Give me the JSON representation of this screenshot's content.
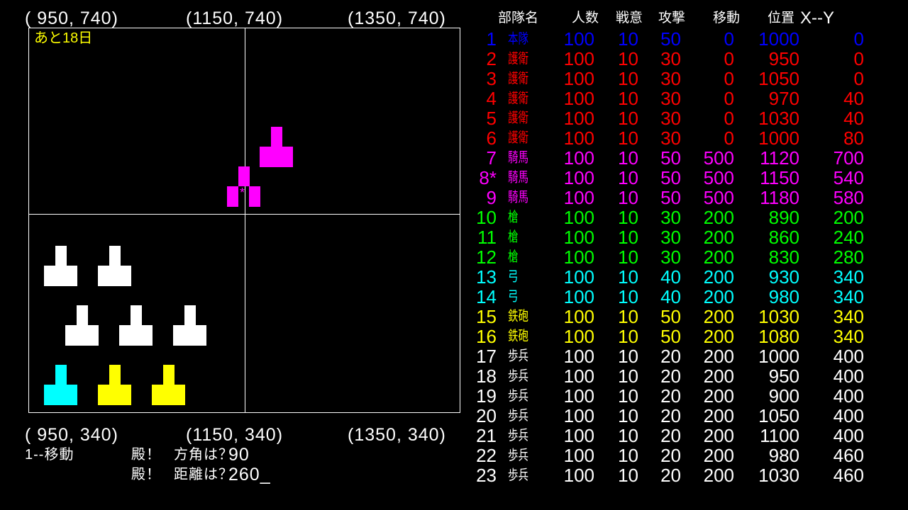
{
  "map": {
    "top_labels": [
      "( 950, 740)",
      "(1150, 740)",
      "(1350, 740)"
    ],
    "bottom_labels": [
      "( 950, 340)",
      "(1150, 340)",
      "(1350, 340)"
    ],
    "days_left": "あと18日",
    "selected_marker": "*"
  },
  "prompt": {
    "command": "1--移動",
    "line1_prefix": "殿！",
    "line1_question": "方角は？",
    "line1_value": "90",
    "line2_prefix": "殿！",
    "line2_question": "距離は？",
    "line2_value": "260_"
  },
  "table": {
    "headers": {
      "name": "部隊名",
      "men": "人数",
      "morale": "戦意",
      "attack": "攻撃",
      "move": "移動",
      "pos": "位置",
      "xy": "X--Y"
    },
    "colors": {
      "blue": "#0000ff",
      "red": "#ff0000",
      "magenta": "#ff00ff",
      "green": "#00ff00",
      "cyan": "#00ffff",
      "yellow": "#ffff00",
      "white": "#ffffff"
    },
    "rows": [
      [
        "1",
        "本隊",
        "100",
        "10",
        "50",
        "0",
        "1000",
        "0",
        "blue"
      ],
      [
        "2",
        "護衛",
        "100",
        "10",
        "30",
        "0",
        "950",
        "0",
        "red"
      ],
      [
        "3",
        "護衛",
        "100",
        "10",
        "30",
        "0",
        "1050",
        "0",
        "red"
      ],
      [
        "4",
        "護衛",
        "100",
        "10",
        "30",
        "0",
        "970",
        "40",
        "red"
      ],
      [
        "5",
        "護衛",
        "100",
        "10",
        "30",
        "0",
        "1030",
        "40",
        "red"
      ],
      [
        "6",
        "護衛",
        "100",
        "10",
        "30",
        "0",
        "1000",
        "80",
        "red"
      ],
      [
        "7",
        "騎馬",
        "100",
        "10",
        "50",
        "500",
        "1120",
        "700",
        "magenta"
      ],
      [
        "8*",
        "騎馬",
        "100",
        "10",
        "50",
        "500",
        "1150",
        "540",
        "magenta"
      ],
      [
        "9",
        "騎馬",
        "100",
        "10",
        "50",
        "500",
        "1180",
        "580",
        "magenta"
      ],
      [
        "10",
        "槍",
        "100",
        "10",
        "30",
        "200",
        "890",
        "200",
        "green"
      ],
      [
        "11",
        "槍",
        "100",
        "10",
        "30",
        "200",
        "860",
        "240",
        "green"
      ],
      [
        "12",
        "槍",
        "100",
        "10",
        "30",
        "200",
        "830",
        "280",
        "green"
      ],
      [
        "13",
        "弓",
        "100",
        "10",
        "40",
        "200",
        "930",
        "340",
        "cyan"
      ],
      [
        "14",
        "弓",
        "100",
        "10",
        "40",
        "200",
        "980",
        "340",
        "cyan"
      ],
      [
        "15",
        "鉄砲",
        "100",
        "10",
        "50",
        "200",
        "1030",
        "340",
        "yellow"
      ],
      [
        "16",
        "鉄砲",
        "100",
        "10",
        "50",
        "200",
        "1080",
        "340",
        "yellow"
      ],
      [
        "17",
        "歩兵",
        "100",
        "10",
        "20",
        "200",
        "1000",
        "400",
        "white"
      ],
      [
        "18",
        "歩兵",
        "100",
        "10",
        "20",
        "200",
        "950",
        "400",
        "white"
      ],
      [
        "19",
        "歩兵",
        "100",
        "10",
        "20",
        "200",
        "900",
        "400",
        "white"
      ],
      [
        "20",
        "歩兵",
        "100",
        "10",
        "20",
        "200",
        "1050",
        "400",
        "white"
      ],
      [
        "21",
        "歩兵",
        "100",
        "10",
        "20",
        "200",
        "1100",
        "400",
        "white"
      ],
      [
        "22",
        "歩兵",
        "100",
        "10",
        "20",
        "200",
        "980",
        "460",
        "white"
      ],
      [
        "23",
        "歩兵",
        "100",
        "10",
        "20",
        "200",
        "1030",
        "460",
        "white"
      ]
    ]
  }
}
